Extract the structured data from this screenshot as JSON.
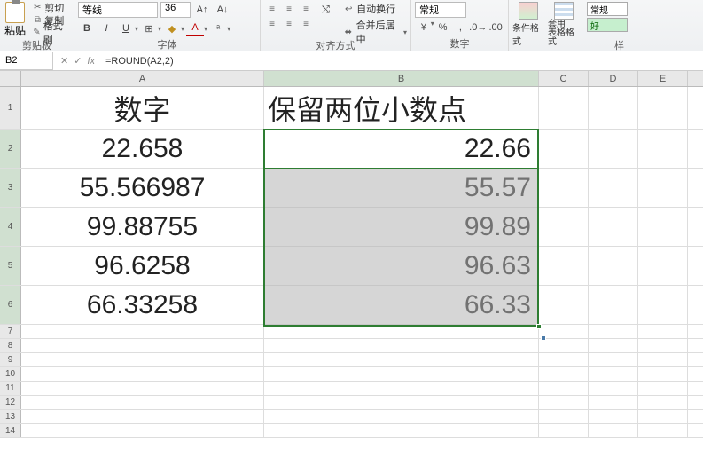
{
  "ribbon": {
    "clipboard": {
      "paste": "粘贴",
      "cut": "剪切",
      "copy": "复制",
      "format_painter": "格式刷",
      "label": "剪贴板"
    },
    "font": {
      "name": "等线",
      "size": "36",
      "bold": "B",
      "italic": "I",
      "underline": "U",
      "label": "字体"
    },
    "alignment": {
      "wrap": "自动换行",
      "merge": "合并后居中",
      "label": "对齐方式"
    },
    "number": {
      "format": "常规",
      "label": "数字"
    },
    "styles": {
      "cond_format": "条件格式",
      "table_format": "套用\n表格格式",
      "normal": "常规",
      "good": "好",
      "label": "样"
    }
  },
  "namebox": "B2",
  "formula": "=ROUND(A2,2)",
  "fx_label": "fx",
  "columns": [
    "A",
    "B",
    "C",
    "D",
    "E"
  ],
  "header_row": {
    "A": "数字",
    "B": "保留两位小数点"
  },
  "chart_data": {
    "type": "table",
    "columns": [
      "数字",
      "保留两位小数点"
    ],
    "rows": [
      {
        "数字": 22.658,
        "保留两位小数点": 22.66
      },
      {
        "数字": 55.566987,
        "保留两位小数点": 55.57
      },
      {
        "数字": 99.88755,
        "保留两位小数点": 99.89
      },
      {
        "数字": 96.6258,
        "保留两位小数点": 96.63
      },
      {
        "数字": 66.33258,
        "保留两位小数点": 66.33
      }
    ]
  }
}
